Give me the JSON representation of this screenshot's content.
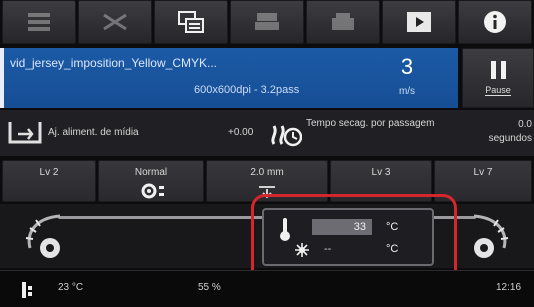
{
  "toolbar": {
    "buttons": [
      {
        "icon": "menu-list-icon",
        "dim": true
      },
      {
        "icon": "cutter-icon",
        "dim": true
      },
      {
        "icon": "job-queue-icon",
        "dim": false
      },
      {
        "icon": "print-settings-icon",
        "dim": true
      },
      {
        "icon": "printer-icon",
        "dim": true
      },
      {
        "icon": "preview-icon",
        "dim": false
      },
      {
        "icon": "info-icon",
        "dim": false
      }
    ]
  },
  "job": {
    "name": "vid_jersey_imposition_Yellow_CMYK...",
    "resolution": "600x600dpi - 3.2pass",
    "count": "3",
    "count_unit": "m/s"
  },
  "pause": {
    "label": "Pause"
  },
  "media_row": {
    "label": "Aj. aliment. de mídia",
    "value": "+0.00",
    "pass_time_label": "Tempo secag. por passagem",
    "seconds_value": "0.0",
    "seconds_unit": "segundos"
  },
  "tabs": [
    {
      "label": "Lv 2"
    },
    {
      "label": "Normal"
    },
    {
      "label": "2.0      mm"
    },
    {
      "label": "Lv 3"
    },
    {
      "label": "Lv 7"
    }
  ],
  "heater": {
    "temperature": "33",
    "temp_unit": "°C",
    "fan_value": "--",
    "fan_unit": "°C"
  },
  "status": {
    "temperature": "23 °C",
    "humidity": "55 %",
    "time": "12:16"
  },
  "colors": {
    "job_banner": "#1c5aa6",
    "highlight": "#d5262d"
  }
}
